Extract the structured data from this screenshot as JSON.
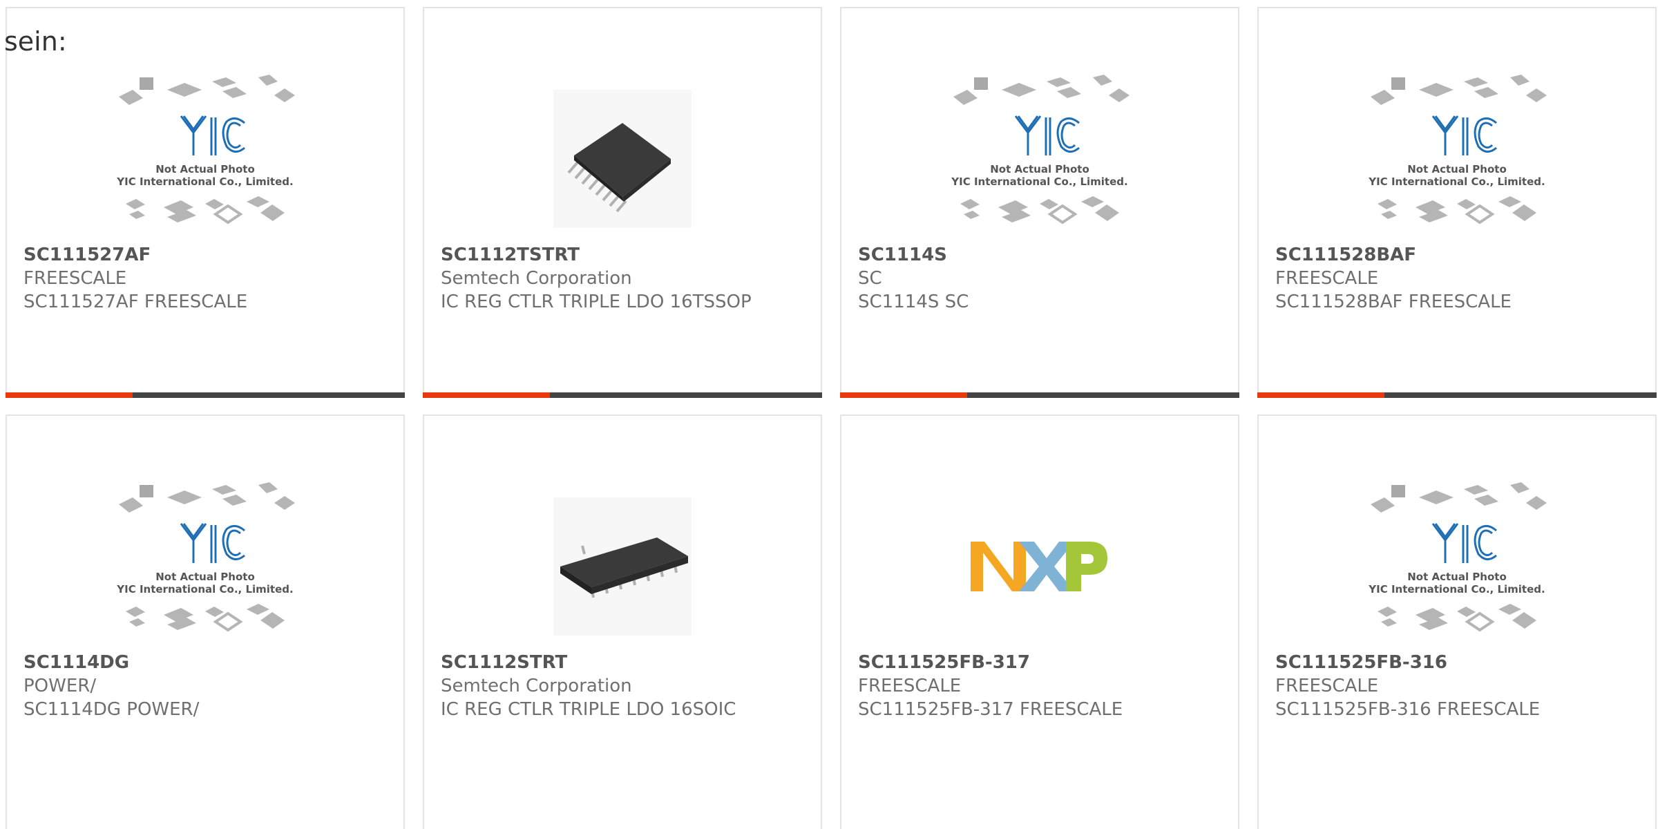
{
  "stray_text": "sein:",
  "colors": {
    "accent_bar": "#e8380d",
    "bar": "#444444",
    "card_border": "#e3e3e3",
    "yic_blue": "#1f6fb5"
  },
  "placeholder": {
    "line1": "Not Actual Photo",
    "line2": "YIC International Co., Limited."
  },
  "products": [
    {
      "part": "SC111527AF",
      "maker": "FREESCALE",
      "desc": "SC111527AF FREESCALE",
      "image": "yic-placeholder"
    },
    {
      "part": "SC1112TSTRT",
      "maker": "Semtech Corporation",
      "desc": "IC REG CTLR TRIPLE LDO 16TSSOP",
      "image": "tssop-chip"
    },
    {
      "part": "SC1114S",
      "maker": "SC",
      "desc": "SC1114S SC",
      "image": "yic-placeholder"
    },
    {
      "part": "SC111528BAF",
      "maker": "FREESCALE",
      "desc": "SC111528BAF FREESCALE",
      "image": "yic-placeholder"
    },
    {
      "part": "SC1114DG",
      "maker": "POWER/",
      "desc": "SC1114DG POWER/",
      "image": "yic-placeholder"
    },
    {
      "part": "SC1112STRT",
      "maker": "Semtech Corporation",
      "desc": "IC REG CTLR TRIPLE LDO 16SOIC",
      "image": "soic-chip"
    },
    {
      "part": "SC111525FB-317",
      "maker": "FREESCALE",
      "desc": "SC111525FB-317 FREESCALE",
      "image": "nxp-logo"
    },
    {
      "part": "SC111525FB-316",
      "maker": "FREESCALE",
      "desc": "SC111525FB-316 FREESCALE",
      "image": "yic-placeholder"
    }
  ]
}
